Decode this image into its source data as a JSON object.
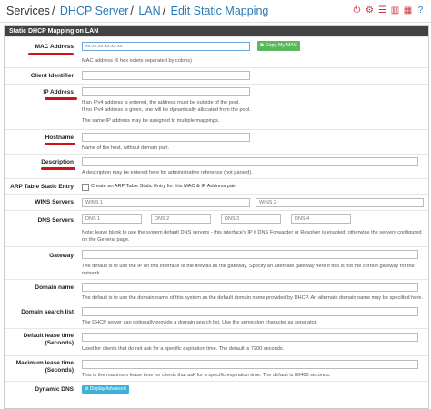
{
  "breadcrumb": {
    "items": [
      "Services",
      "DHCP Server",
      "LAN",
      "Edit Static Mapping"
    ],
    "sep": "/"
  },
  "header_icons": [
    "toggle-icon",
    "gear-icon",
    "list-icon",
    "chart-icon",
    "table-icon",
    "help-icon"
  ],
  "panel": {
    "title": "Static DHCP Mapping on LAN"
  },
  "fields": {
    "mac": {
      "label": "MAC Address",
      "placeholder": "xx:xx:xx:xx:xx:xx",
      "button": "Copy My MAC",
      "help": "MAC address (6 hex octets separated by colons)"
    },
    "client_id": {
      "label": "Client Identifier"
    },
    "ip": {
      "label": "IP Address",
      "help1": "If an IPv4 address is entered, the address must be outside of the pool.",
      "help2": "If no IPv4 address is given, one will be dynamically allocated from the pool.",
      "help3": "The same IP address may be assigned to multiple mappings."
    },
    "hostname": {
      "label": "Hostname",
      "help": "Name of the host, without domain part."
    },
    "description": {
      "label": "Description",
      "help": "A description may be entered here for administrative reference (not parsed)."
    },
    "arp": {
      "label": "ARP Table Static Entry",
      "help": "Create an ARP Table Static Entry for this MAC & IP Address pair."
    },
    "wins": {
      "label": "WINS Servers",
      "ph1": "WINS 1",
      "ph2": "WINS 2"
    },
    "dns": {
      "label": "DNS Servers",
      "ph1": "DNS 1",
      "ph2": "DNS 2",
      "ph3": "DNS 3",
      "ph4": "DNS 4",
      "help1": "Note: leave blank to use the system default DNS servers - this interface's IP if DNS Forwarder or Resolver is enabled, otherwise the servers configured",
      "help2": "on the General page."
    },
    "gateway": {
      "label": "Gateway",
      "help1": "The default is to use the IP on this interface of the firewall as the gateway. Specify an alternate gateway here if this is not the correct gateway for the",
      "help2": "network."
    },
    "domain": {
      "label": "Domain name",
      "help": "The default is to use the domain name of this system as the default domain name provided by DHCP. An alternate domain name may be specified here."
    },
    "search": {
      "label": "Domain search list",
      "help": "The DHCP server can optionally provide a domain search list. Use the semicolon character as separator."
    },
    "def_lease": {
      "label1": "Default lease time",
      "label2": "(Seconds)",
      "help": "Used for clients that do not ask for a specific expiration time. The default is 7200 seconds."
    },
    "max_lease": {
      "label1": "Maximum lease time",
      "label2": "(Seconds)",
      "help": "This is the maximum lease time for clients that ask for a specific expiration time. The default is 86400 seconds."
    },
    "ddns": {
      "label": "Dynamic DNS",
      "button": "Display Advanced"
    }
  }
}
